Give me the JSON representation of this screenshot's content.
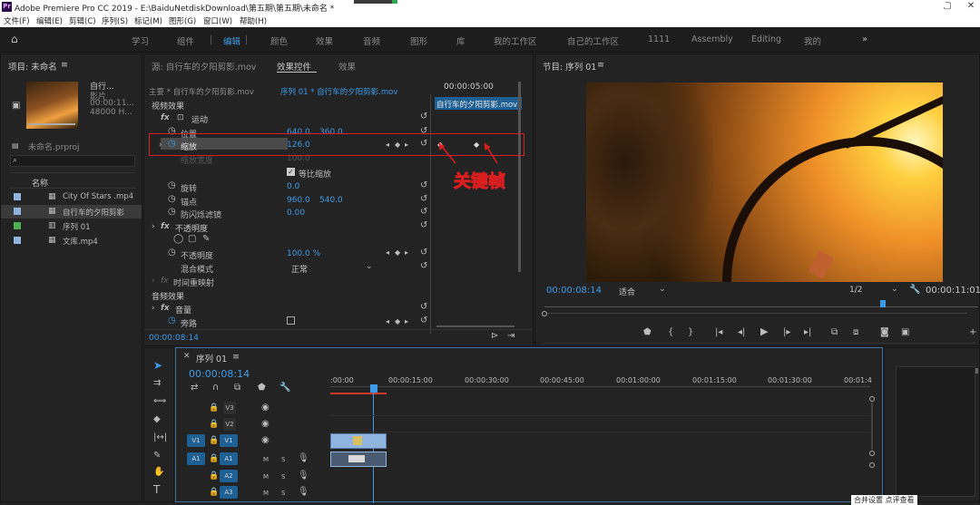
{
  "app": {
    "title": "Adobe Premiere Pro CC 2019 - E:\\BaiduNetdiskDownload\\第五期\\第五期\\未命名 *",
    "logo": "Pr",
    "min": "—",
    "max": "▢",
    "close": "✕"
  },
  "menu": [
    "文件(F)",
    "编辑(E)",
    "剪辑(C)",
    "序列(S)",
    "标记(M)",
    "图形(G)",
    "窗口(W)",
    "帮助(H)"
  ],
  "workspaces": [
    "学习",
    "组件",
    "编辑",
    "颜色",
    "效果",
    "音频",
    "图形",
    "库",
    "我的工作区",
    "自己的工作区",
    "1111",
    "Assembly",
    "Editing",
    "我的"
  ],
  "project": {
    "title": "项目: 未命名",
    "menu_glyph": "≡",
    "clip_name": "自行...",
    "clip_type": "影片",
    "clip_dur": "00:00:11...",
    "clip_rate": "48000 H...",
    "proj_file": "未命名.prproj",
    "name_header": "名称",
    "items": [
      {
        "name": "City Of Stars .mp4",
        "color": "#8fb4e0"
      },
      {
        "name": "自行车的夕阳剪影",
        "color": "#8fb4e0"
      },
      {
        "name": "序列 01",
        "color": "#4caf50"
      },
      {
        "name": "文库.mp4",
        "color": "#8fb4e0"
      }
    ]
  },
  "effects": {
    "tab_source": "源: 自行车的夕阳剪影.mov",
    "tab_controls": "效果控件",
    "tab_fx": "效果",
    "master": "主要 * 自行车的夕阳剪影.mov",
    "seq_path": "序列 01 * 自行车的夕阳剪影.mov",
    "timecode_head": "00:00:05:00",
    "clip_label": "自行车的夕阳剪影.mov",
    "video_fx": "视频效果",
    "motion": "运动",
    "position": "位置",
    "pos_x": "640.0",
    "pos_y": "360.0",
    "scale": "缩放",
    "scale_val": "126.0",
    "scale_width": "缩放宽度",
    "scale_width_val": "100.0",
    "uniform": "等比缩放",
    "rotation": "旋转",
    "rotation_val": "0.0",
    "anchor": "锚点",
    "anchor_x": "960.0",
    "anchor_y": "540.0",
    "flicker": "防闪烁滤镜",
    "flicker_val": "0.00",
    "opacity_group": "不透明度",
    "opacity": "不透明度",
    "opacity_val": "100.0 %",
    "blend": "混合模式",
    "blend_val": "正常",
    "time_remap": "时间重映射",
    "audio_fx": "音频效果",
    "volume": "音量",
    "bypass": "旁路",
    "footer_tc": "00:00:08:14"
  },
  "annotation": "关键帧",
  "program": {
    "title": "节目: 序列 01",
    "timecode": "00:00:08:14",
    "fit": "适合",
    "zoom": "1/2",
    "duration": "00:00:11:01"
  },
  "timeline": {
    "title": "序列 01",
    "timecode": "00:00:08:14",
    "ruler": [
      ":00:00",
      "00:00:15:00",
      "00:00:30:00",
      "00:00:45:00",
      "00:01:00:00",
      "00:01:15:00",
      "00:01:30:00",
      "00:01:4"
    ],
    "tracks": [
      {
        "src": "",
        "name": "V3",
        "m": "",
        "s": ""
      },
      {
        "src": "",
        "name": "V2",
        "m": "",
        "s": ""
      },
      {
        "src": "V1",
        "name": "V1",
        "m": "",
        "s": ""
      },
      {
        "src": "A1",
        "name": "A1",
        "m": "M",
        "s": "S"
      },
      {
        "src": "",
        "name": "A2",
        "m": "M",
        "s": "S"
      },
      {
        "src": "",
        "name": "A3",
        "m": "M",
        "s": "S"
      }
    ]
  },
  "bottom_right": "合并设置 点评查看"
}
